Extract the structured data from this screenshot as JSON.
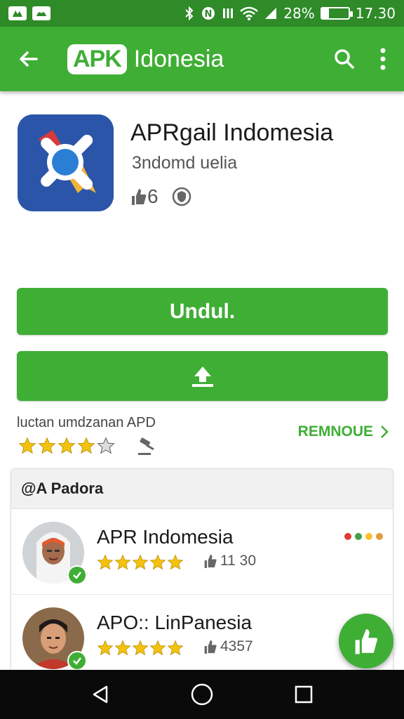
{
  "status_bar": {
    "notif_icons": [
      "sim-notification-icon",
      "gift-notification-icon"
    ],
    "battery_percent": "28%",
    "battery_level": 0.28,
    "time": "17.30"
  },
  "app_bar": {
    "logo_box": "APK",
    "logo_text": "Idonesia"
  },
  "app": {
    "title": "APRgail Indomesia",
    "developer": "3ndomd uelia",
    "likes": "6"
  },
  "buttons": {
    "download_label": "Undul."
  },
  "rating": {
    "caption": "luctan umdzanan APD",
    "stars": 4,
    "remove_label": "REMNOUE"
  },
  "card": {
    "header": "@A Padora",
    "items": [
      {
        "title": "APR Indomesia",
        "stars": 5,
        "count": "11 30"
      },
      {
        "title": "APO:: LinPanesia",
        "stars": 5,
        "count": "4357"
      }
    ]
  },
  "colors": {
    "primary": "#3fae35",
    "status_bar": "#2e8b28",
    "star": "#f4c20d",
    "dot_red": "#e53935",
    "dot_green": "#43a047",
    "dot_yellow": "#fbc02d",
    "dot_orange": "#e69a3a"
  }
}
